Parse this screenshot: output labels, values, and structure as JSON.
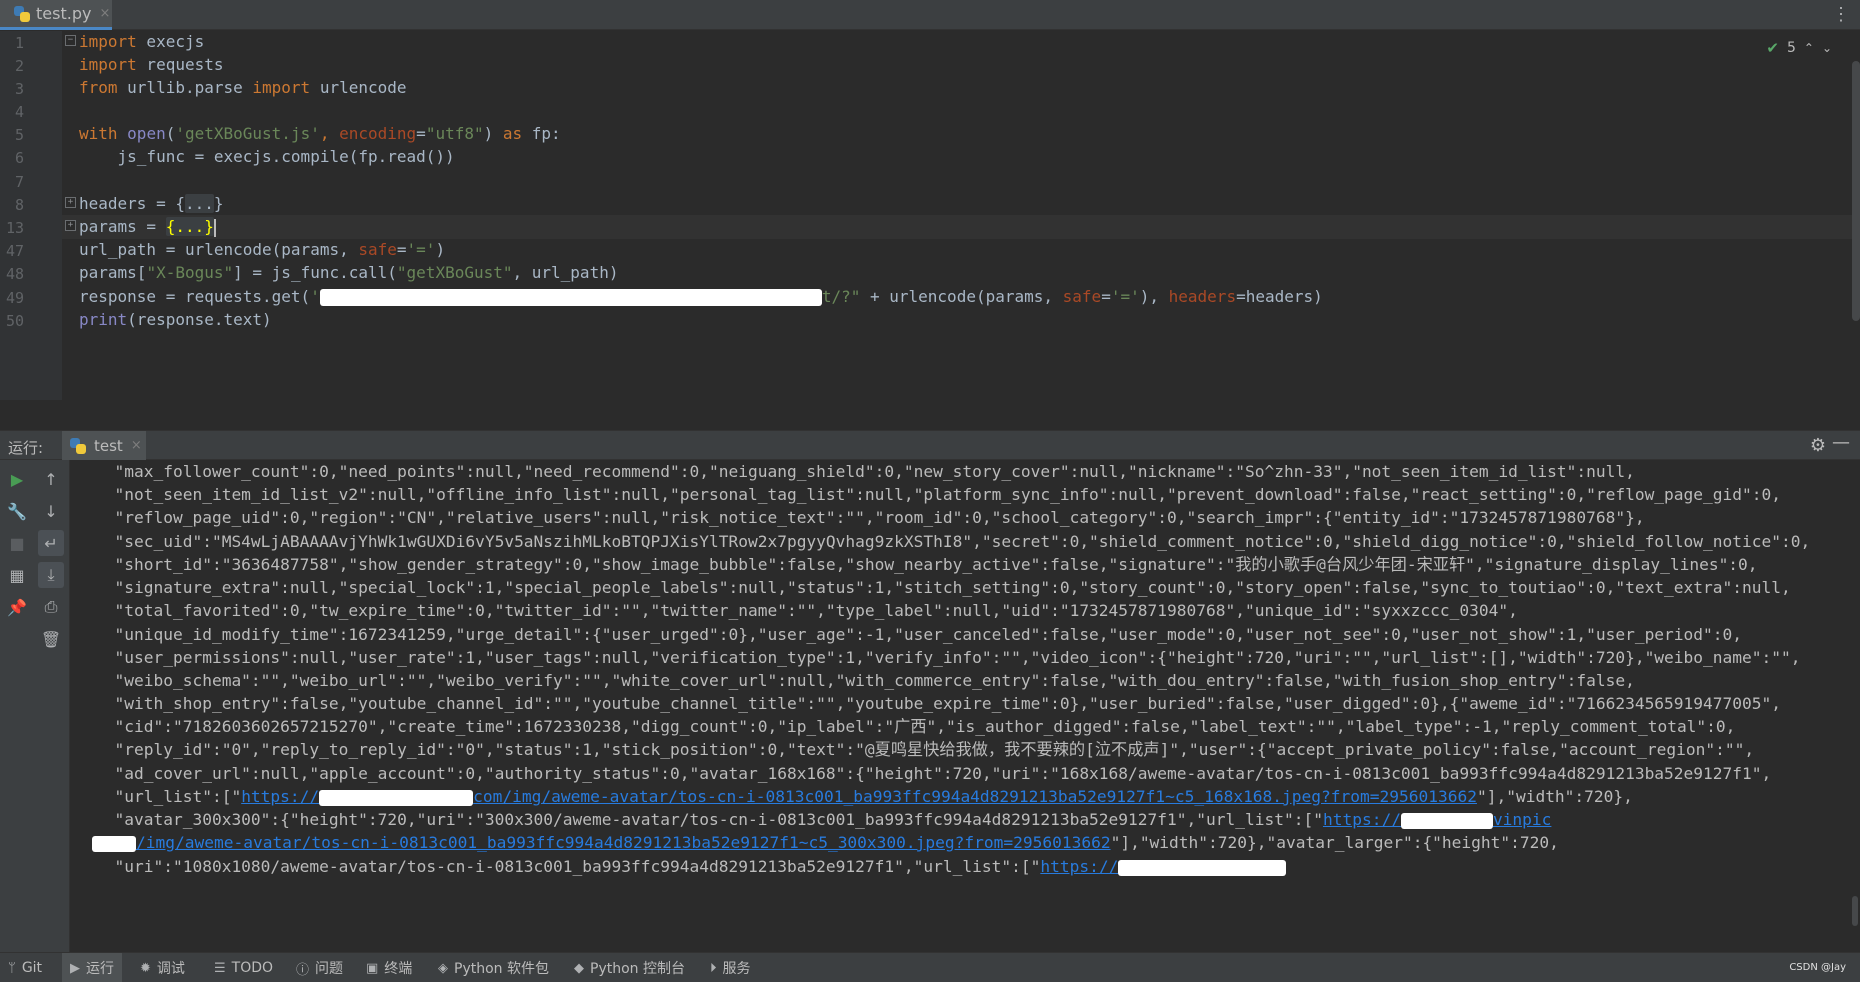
{
  "editor_tab": {
    "filename": "test.py",
    "close": "×"
  },
  "editor_status": {
    "problems_count": "5"
  },
  "line_numbers": [
    "1",
    "2",
    "3",
    "4",
    "5",
    "6",
    "7",
    "8",
    "13",
    "47",
    "48",
    "49",
    "50"
  ],
  "code": {
    "l1": {
      "kw": "import",
      "rest": " execjs"
    },
    "l2": {
      "kw": "import",
      "rest": " requests"
    },
    "l3": {
      "kw1": "from",
      "mid": " urllib.parse ",
      "kw2": "import",
      "rest": " urlencode"
    },
    "l5": {
      "kw": "with ",
      "fn": "open",
      "p1": "(",
      "s1": "'getXBoGust.js'",
      "p2": ", ",
      "param": "encoding",
      "eq": "=",
      "s2": "\"utf8\"",
      "p3": ") ",
      "kw2": "as",
      "rest": " fp:"
    },
    "l6": {
      "text": "    js_func = execjs.compile(fp.read())"
    },
    "l8": {
      "pre": "headers = {",
      "fold": "...",
      "post": "}"
    },
    "l13": {
      "pre": "params = ",
      "fold": "{...}"
    },
    "l47": {
      "pre": "url_path = urlencode(params, ",
      "param": "safe",
      "eq": "=",
      "s": "'='",
      "post": ")"
    },
    "l48": {
      "pre": "params[",
      "s1": "\"X-Bogus\"",
      "mid": "] = js_func.call(",
      "s2": "\"getXBoGust\"",
      "post": ", url_path)"
    },
    "l49": {
      "pre": "response = requests.get(",
      "s1": "'",
      "s1tail": "t/?\"",
      "mid": " + urlencode(params, ",
      "param1": "safe",
      "eq1": "=",
      "s2": "'='",
      "mid2": "), ",
      "param2": "headers",
      "eq2": "=",
      "post": "headers)"
    },
    "l50": {
      "fn": "print",
      "rest": "(response.text)"
    }
  },
  "run_panel": {
    "label": "运行:",
    "tab": "test",
    "close": "×"
  },
  "output": [
    "  \"max_follower_count\":0,\"need_points\":null,\"need_recommend\":0,\"neiguang_shield\":0,\"new_story_cover\":null,\"nickname\":\"So^zhn-33\",\"not_seen_item_id_list\":null,",
    "  \"not_seen_item_id_list_v2\":null,\"offline_info_list\":null,\"personal_tag_list\":null,\"platform_sync_info\":null,\"prevent_download\":false,\"react_setting\":0,\"reflow_page_gid\":0,",
    "  \"reflow_page_uid\":0,\"region\":\"CN\",\"relative_users\":null,\"risk_notice_text\":\"\",\"room_id\":0,\"school_category\":0,\"search_impr\":{\"entity_id\":\"1732457871980768\"},",
    "  \"sec_uid\":\"MS4wLjABAAAAvjYhWk1wGUXDi6vY5v5aNszihMLkoBTQPJXisYlTRow2x7pgyyQvhag9zkXSThI8\",\"secret\":0,\"shield_comment_notice\":0,\"shield_digg_notice\":0,\"shield_follow_notice\":0,",
    "  \"short_id\":\"3636487758\",\"show_gender_strategy\":0,\"show_image_bubble\":false,\"show_nearby_active\":false,\"signature\":\"我的小歌手@台风少年团-宋亚轩\",\"signature_display_lines\":0,",
    "  \"signature_extra\":null,\"special_lock\":1,\"special_people_labels\":null,\"status\":1,\"stitch_setting\":0,\"story_count\":0,\"story_open\":false,\"sync_to_toutiao\":0,\"text_extra\":null,",
    "  \"total_favorited\":0,\"tw_expire_time\":0,\"twitter_id\":\"\",\"twitter_name\":\"\",\"type_label\":null,\"uid\":\"1732457871980768\",\"unique_id\":\"syxxzccc_0304\",",
    "  \"unique_id_modify_time\":1672341259,\"urge_detail\":{\"user_urged\":0},\"user_age\":-1,\"user_canceled\":false,\"user_mode\":0,\"user_not_see\":0,\"user_not_show\":1,\"user_period\":0,",
    "  \"user_permissions\":null,\"user_rate\":1,\"user_tags\":null,\"verification_type\":1,\"verify_info\":\"\",\"video_icon\":{\"height\":720,\"uri\":\"\",\"url_list\":[],\"width\":720},\"weibo_name\":\"\",",
    "  \"weibo_schema\":\"\",\"weibo_url\":\"\",\"weibo_verify\":\"\",\"white_cover_url\":null,\"with_commerce_entry\":false,\"with_dou_entry\":false,\"with_fusion_shop_entry\":false,",
    "  \"with_shop_entry\":false,\"youtube_channel_id\":\"\",\"youtube_channel_title\":\"\",\"youtube_expire_time\":0},\"user_buried\":false,\"user_digged\":0},{\"aweme_id\":\"7166234565919477005\",",
    "  \"cid\":\"7182603602657215270\",\"create_time\":1672330238,\"digg_count\":0,\"ip_label\":\"广西\",\"is_author_digged\":false,\"label_text\":\"\",\"label_type\":-1,\"reply_comment_total\":0,",
    "  \"reply_id\":\"0\",\"reply_to_reply_id\":\"0\",\"status\":1,\"stick_position\":0,\"text\":\"@夏鸣星快给我做，我不要辣的[泣不成声]\",\"user\":{\"accept_private_policy\":false,\"account_region\":\"\",",
    "  \"ad_cover_url\":null,\"apple_account\":0,\"authority_status\":0,\"avatar_168x168\":{\"height\":720,\"uri\":\"168x168/aweme-avatar/tos-cn-i-0813c001_ba993ffc994a4d8291213ba52e9127f1\","
  ],
  "output_l15": {
    "pre": "  \"url_list\":[\"",
    "link1": "https://",
    "link2": "com/img/aweme-avatar/tos-cn-i-0813c001_ba993ffc994a4d8291213ba52e9127f1~c5_168x168.jpeg?from=2956013662",
    "post": "\"],\"width\":720},"
  },
  "output_l16": {
    "pre": "  \"avatar_300x300\":{\"height\":720,\"uri\":\"300x300/aweme-avatar/tos-cn-i-0813c001_ba993ffc994a4d8291213ba52e9127f1\",\"url_list\":[\"",
    "link1": "https://",
    "link2": "vinpic"
  },
  "output_l17": {
    "link": "/img/aweme-avatar/tos-cn-i-0813c001_ba993ffc994a4d8291213ba52e9127f1~c5_300x300.jpeg?from=2956013662",
    "post": "\"],\"width\":720},\"avatar_larger\":{\"height\":720,"
  },
  "output_l18": {
    "pre": "  \"uri\":\"1080x1080/aweme-avatar/tos-cn-i-0813c001_ba993ffc994a4d8291213ba52e9127f1\",\"url_list\":[\"",
    "link": "https://"
  },
  "bottom_bar": {
    "git": "Git",
    "run": "运行",
    "debug": "调试",
    "todo": "TODO",
    "problems": "问题",
    "terminal": "终端",
    "packages": "Python 软件包",
    "console": "Python 控制台",
    "services": "服务",
    "watermark": "CSDN @Jay"
  }
}
